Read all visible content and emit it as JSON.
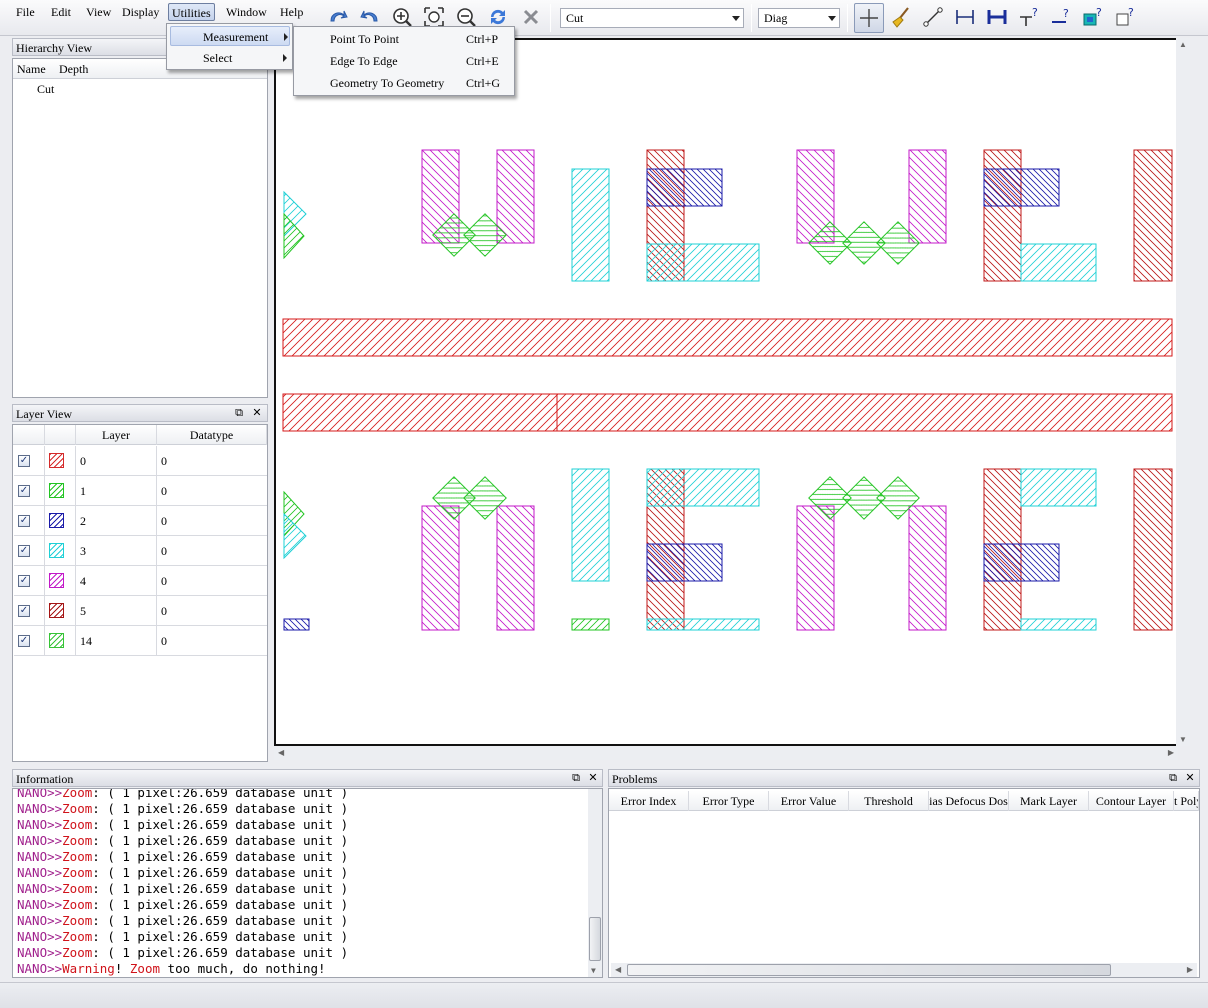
{
  "menubar": {
    "items": [
      "File",
      "Edit",
      "View",
      "Display",
      "Utilities",
      "Window",
      "Help"
    ],
    "active": "Utilities"
  },
  "toolbar": {
    "cell_combo": "Cut",
    "mode_combo": "Diag",
    "icons": [
      "redo-icon",
      "undo-icon",
      "zoom-in-icon",
      "zoom-fit-icon",
      "zoom-out-icon",
      "refresh-icon",
      "cancel-icon",
      "select-cross-icon",
      "broom-icon",
      "ruler-point-icon",
      "ruler-edge-icon",
      "ruler-edge-bold-icon",
      "ruler-query-icon",
      "ruler-query2-icon",
      "geometry-query-icon",
      "polygon-query-icon"
    ]
  },
  "utilities_menu": {
    "items": [
      "Measurement",
      "Select"
    ]
  },
  "measurement_submenu": {
    "items": [
      {
        "label": "Point To Point",
        "shortcut": "Ctrl+P"
      },
      {
        "label": "Edge To Edge",
        "shortcut": "Ctrl+E"
      },
      {
        "label": "Geometry To Geometry",
        "shortcut": "Ctrl+G"
      }
    ]
  },
  "hierarchy": {
    "title": "Hierarchy View",
    "columns": [
      "Name",
      "Depth"
    ],
    "rows": [
      "Cut"
    ]
  },
  "layer_view": {
    "title": "Layer View",
    "columns": [
      "Layer",
      "Datatype"
    ],
    "rows": [
      {
        "layer": "0",
        "datatype": "0",
        "color": "#d42a2a",
        "checked": "✓"
      },
      {
        "layer": "1",
        "datatype": "0",
        "color": "#22c422",
        "checked": "✓"
      },
      {
        "layer": "2",
        "datatype": "0",
        "color": "#1a1aa8",
        "checked": "✓"
      },
      {
        "layer": "3",
        "datatype": "0",
        "color": "#1fd0d6",
        "checked": "✓"
      },
      {
        "layer": "4",
        "datatype": "0",
        "color": "#c318c9",
        "checked": "✓"
      },
      {
        "layer": "5",
        "datatype": "0",
        "color": "#a51414",
        "checked": "✓"
      },
      {
        "layer": "14",
        "datatype": "0",
        "color": "#36c436",
        "checked": "✓"
      }
    ]
  },
  "information": {
    "title": "Information",
    "prefix": "NANO>>",
    "zoom_kw": "Zoom",
    "zoom_rest": ": ( 1 pixel:26.659 database unit )",
    "warning_kw": "Warning",
    "warning_excl": "! ",
    "warning_zoom": "Zoom",
    "warning_rest": " too much, do nothing!"
  },
  "problems": {
    "title": "Problems",
    "columns": [
      "Error Index",
      "Error Type",
      "Error Value",
      "Threshold",
      "ias Defocus Dos",
      "Mark Layer",
      "Contour Layer",
      "t Poly"
    ]
  },
  "colors": {
    "red": "#d0131a",
    "magenta": "#c318c9",
    "green": "#22c422",
    "blue": "#1a1aa8",
    "cyan": "#1fd0d6",
    "darkred": "#b01515"
  }
}
